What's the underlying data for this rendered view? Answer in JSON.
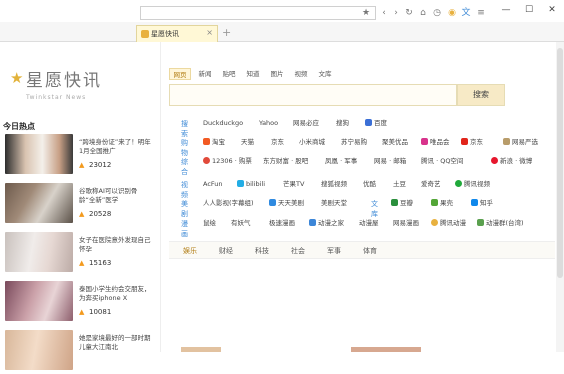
{
  "window": {
    "tab_title": "星愿快讯",
    "tab_close": "×",
    "new_tab": "+",
    "controls": {
      "minimize": "—",
      "maximize": "☐",
      "close": "✕"
    },
    "toolbar_icons": {
      "star": "★",
      "back": "‹",
      "forward": "›",
      "refresh": "↻",
      "home": "⌂",
      "history": "◷",
      "extension": "◉",
      "translate": "文",
      "menu": "≡"
    }
  },
  "brand": {
    "name": "星愿快讯",
    "subtitle": "Twinkstar News"
  },
  "sidebar": {
    "hot_title": "今日热点",
    "fire_icon": "🔥",
    "news": [
      {
        "title": "“跨境身份证”来了！明年1月全国推广",
        "count": "23012"
      },
      {
        "title": "谷歌称AI可以识别骨龄“全新”医学",
        "count": "20528"
      },
      {
        "title": "女子在医院意外发现自己怀孕",
        "count": "15163"
      },
      {
        "title": "泰国小学生约会交朋友，为奔买iphone X",
        "count": "10081"
      },
      {
        "title": "她是家境最好的一部时期儿童大江南北",
        "count": ""
      }
    ]
  },
  "search": {
    "tabs": [
      "网页",
      "新闻",
      "贴吧",
      "知道",
      "图片",
      "视频",
      "文库"
    ],
    "active_tab": "网页",
    "button": "搜索",
    "placeholder": ""
  },
  "nav_rows": [
    {
      "label": "搜索",
      "links": [
        "Duckduckgo",
        "Yahoo",
        "网易必应",
        "搜狗",
        "百度"
      ]
    },
    {
      "label": "购物",
      "links": [
        "淘宝",
        "天猫",
        "京东",
        "小米商城",
        "苏宁易购",
        "聚美优品",
        "唯品会",
        "京东",
        "网易严选"
      ]
    },
    {
      "label": "综合",
      "links": [
        "12306 · 购票",
        "东方财富 · 股吧",
        "凤凰 · 军事",
        "网易 · 邮箱",
        "腾讯 · QQ空间",
        "新浪 · 微博"
      ]
    },
    {
      "label": "视频",
      "links": [
        "AcFun",
        "bilibili",
        "芒果TV",
        "搜狐视频",
        "优酷",
        "土豆",
        "爱奇艺",
        "腾讯视频"
      ]
    },
    {
      "label": "美剧",
      "links": [
        "人人影视(字幕组)",
        "天天美剧",
        "美剧天堂",
        "文库",
        "豆瓣",
        "果壳",
        "知乎"
      ]
    },
    {
      "label": "漫画",
      "links": [
        "鼠绘",
        "有妖气",
        "极速漫画",
        "动漫之家",
        "动漫屋",
        "网易漫画",
        "腾讯动漫",
        "动漫群(台湾)"
      ]
    }
  ],
  "categories": [
    "娱乐",
    "财经",
    "科技",
    "社会",
    "军事",
    "体育"
  ],
  "active_category": "娱乐",
  "colors": {
    "accent": "#b07b10",
    "link_label": "#3e8ad6",
    "tab_bg": "#fff8d6",
    "search_btn": "#f7eac6"
  }
}
